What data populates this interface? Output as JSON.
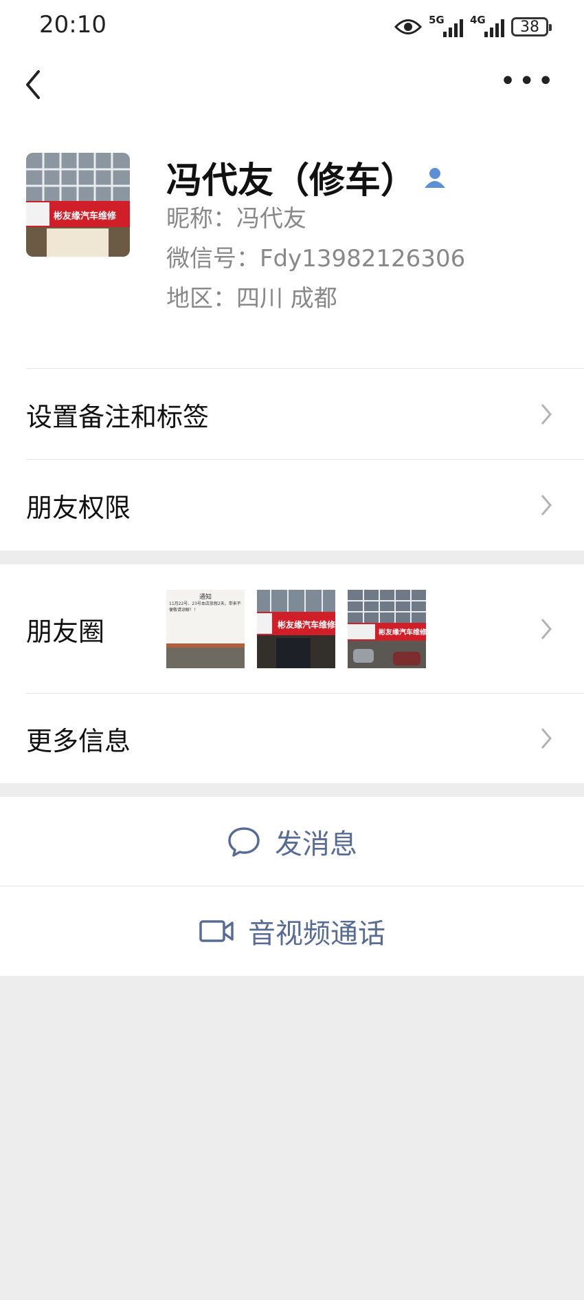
{
  "status_bar": {
    "time": "20:10",
    "net1": "5G",
    "net2": "4G",
    "battery": "38"
  },
  "profile": {
    "name": "冯代友（修车）",
    "nickname": "昵称：冯代友",
    "wechat_id": "微信号：Fdy13982126306",
    "region": "地区：四川  成都"
  },
  "avatar_sign_text": "彬友缘汽车维修",
  "rows": {
    "remark_tags": "设置备注和标签",
    "friend_permissions": "朋友权限",
    "moments": "朋友圈",
    "more_info": "更多信息"
  },
  "moments_thumbs": {
    "notice_title": "通知",
    "notice_body": "11月22号、23号本店放假2天，带来不便敬请谅解！！",
    "sign_text": "彬友缘汽车维修"
  },
  "actions": {
    "send_message": "发消息",
    "av_call": "音视频通话"
  },
  "colors": {
    "accent": "#576b95",
    "background": "#ededed"
  },
  "icons": [
    "back-arrow-icon",
    "more-icon",
    "person-icon",
    "chevron-right-icon",
    "chat-bubble-icon",
    "video-camera-icon"
  ]
}
